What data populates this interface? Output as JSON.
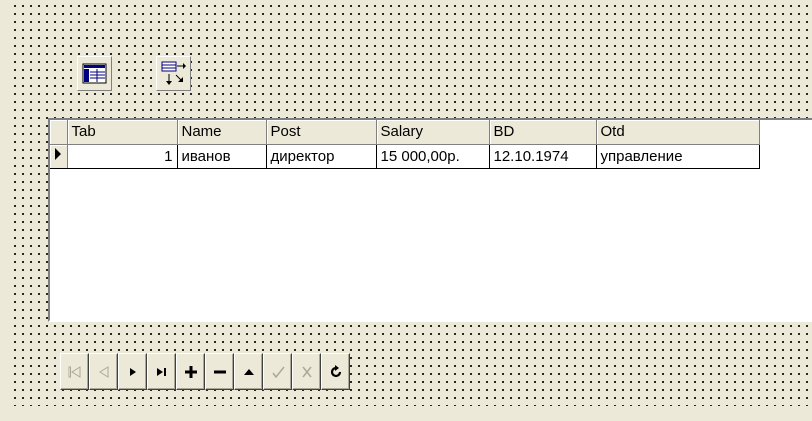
{
  "grid": {
    "columns": [
      "Tab",
      "Name",
      "Post",
      "Salary",
      "BD",
      "Otd"
    ],
    "rows": [
      {
        "tab": "1",
        "name": "иванов",
        "post": "директор",
        "salary": "15 000,00р.",
        "bd": "12.10.1974",
        "otd": "управление"
      }
    ],
    "row_indicator": "▶"
  },
  "components": [
    {
      "name": "table-component-icon",
      "icon": "table-icon"
    },
    {
      "name": "datasource-component-icon",
      "icon": "datasource-icon"
    }
  ],
  "navigator": {
    "buttons": [
      {
        "name": "nav-first",
        "icon": "first-record-icon",
        "enabled": false
      },
      {
        "name": "nav-prior",
        "icon": "prior-record-icon",
        "enabled": false
      },
      {
        "name": "nav-next",
        "icon": "next-record-icon",
        "enabled": true
      },
      {
        "name": "nav-last",
        "icon": "last-record-icon",
        "enabled": true
      },
      {
        "name": "nav-insert",
        "icon": "insert-record-icon",
        "enabled": true
      },
      {
        "name": "nav-delete",
        "icon": "delete-record-icon",
        "enabled": true
      },
      {
        "name": "nav-edit",
        "icon": "edit-record-icon",
        "enabled": true
      },
      {
        "name": "nav-post",
        "icon": "post-record-icon",
        "enabled": false
      },
      {
        "name": "nav-cancel",
        "icon": "cancel-record-icon",
        "enabled": false
      },
      {
        "name": "nav-refresh",
        "icon": "refresh-icon",
        "enabled": true
      }
    ]
  },
  "colors": {
    "surface": "#ece9d8",
    "disabled": "#aca899",
    "enabled": "#000000"
  }
}
